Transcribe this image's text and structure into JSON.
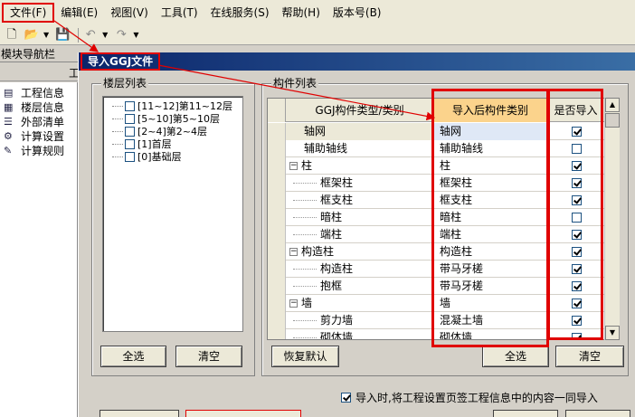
{
  "menubar": {
    "items": [
      "文件(F)",
      "编辑(E)",
      "视图(V)",
      "工具(T)",
      "在线服务(S)",
      "帮助(H)",
      "版本号(B)"
    ]
  },
  "nav": {
    "header": "模块导航栏",
    "sub_label": "工",
    "items": [
      {
        "label": "工程信息",
        "icon": "document-icon"
      },
      {
        "label": "楼层信息",
        "icon": "floors-icon"
      },
      {
        "label": "外部清单",
        "icon": "list-icon"
      },
      {
        "label": "计算设置",
        "icon": "settings-icon"
      },
      {
        "label": "计算规则",
        "icon": "rules-icon"
      }
    ]
  },
  "dialog": {
    "title": "导入GGJ文件",
    "floor_group_label": "楼层列表",
    "floors": [
      {
        "label": "[11~12]第11~12层",
        "checked": false
      },
      {
        "label": "[5~10]第5~10层",
        "checked": false
      },
      {
        "label": "[2~4]第2~4层",
        "checked": false
      },
      {
        "label": "[1]首层",
        "checked": false
      },
      {
        "label": "[0]基础层",
        "checked": false
      }
    ],
    "floor_select_all": "全选",
    "floor_clear": "清空",
    "component_group_label": "构件列表",
    "table": {
      "col_type": "GGJ构件类型/类别",
      "col_category": "导入后构件类别",
      "col_import": "是否导入",
      "rows": [
        {
          "type": "轴网",
          "category": "轴网",
          "checked": true,
          "level": 0,
          "selected": true
        },
        {
          "type": "辅助轴线",
          "category": "辅助轴线",
          "checked": false,
          "level": 0
        },
        {
          "type": "柱",
          "category": "柱",
          "checked": true,
          "level": 1
        },
        {
          "type": "框架柱",
          "category": "框架柱",
          "checked": true,
          "level": 2
        },
        {
          "type": "框支柱",
          "category": "框支柱",
          "checked": true,
          "level": 2
        },
        {
          "type": "暗柱",
          "category": "暗柱",
          "checked": false,
          "level": 2
        },
        {
          "type": "端柱",
          "category": "端柱",
          "checked": true,
          "level": 2
        },
        {
          "type": "构造柱",
          "category": "构造柱",
          "checked": true,
          "level": 1
        },
        {
          "type": "构造柱",
          "category": "带马牙槎",
          "checked": true,
          "level": 2
        },
        {
          "type": "抱框",
          "category": "带马牙槎",
          "checked": true,
          "level": 2
        },
        {
          "type": "墙",
          "category": "墙",
          "checked": true,
          "level": 1
        },
        {
          "type": "剪力墙",
          "category": "混凝土墙",
          "checked": true,
          "level": 2
        },
        {
          "type": "砌体墙",
          "category": "砌体墙",
          "checked": true,
          "level": 2
        }
      ]
    },
    "restore_default": "恢复默认",
    "comp_select_all": "全选",
    "comp_clear": "清空",
    "import_note": "导入时,将工程设置页签工程信息中的内容一同导入",
    "import_note_checked": true
  },
  "colors": {
    "highlight": "#e00000",
    "title_bar": "#0a246a",
    "header_accent": "#fbd38c"
  }
}
